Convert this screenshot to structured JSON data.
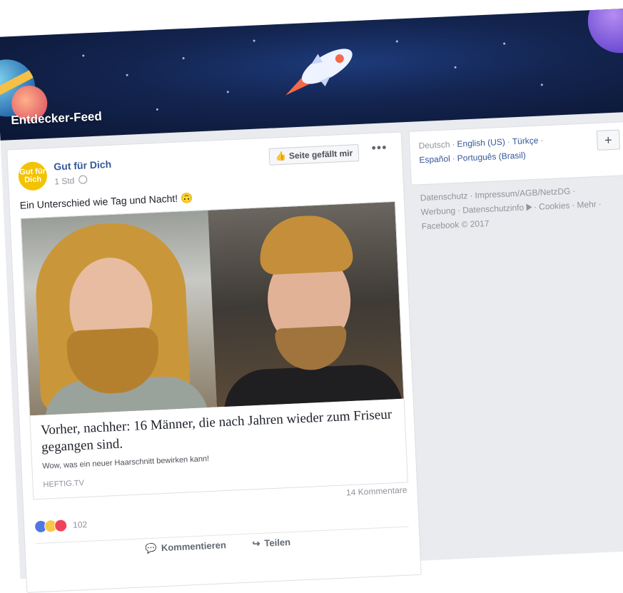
{
  "banner": {
    "title": "Entdecker-Feed"
  },
  "post": {
    "avatar_text": "Gut für Dich",
    "page_name": "Gut für Dich",
    "time": "1 Std",
    "like_page_label": "Seite gefällt mir",
    "more_label": "•••",
    "text": "Ein Unterschied wie Tag und Nacht! 🙃",
    "link": {
      "title": "Vorher, nachher: 16 Männer, die nach Jahren wieder zum Friseur gegangen sind.",
      "description": "Wow, was ein neuer Haarschnitt bewirken kann!",
      "domain": "HEFTIG.TV"
    },
    "comments_count": "14 Kommentare",
    "reactions": {
      "icons": [
        "like-icon",
        "wow-icon",
        "love-icon"
      ],
      "count": "102"
    },
    "actions": {
      "comment": "Kommentieren",
      "share": "Teilen"
    }
  },
  "languages": {
    "items": [
      {
        "label": "Deutsch",
        "current": true
      },
      {
        "label": "English (US)",
        "current": false
      },
      {
        "label": "Türkçe",
        "current": false
      },
      {
        "label": "Español",
        "current": false
      },
      {
        "label": "Português (Brasil)",
        "current": false
      }
    ],
    "add_label": "+"
  },
  "footer": {
    "datenschutz": "Datenschutz",
    "impressum": "Impressum/AGB/NetzDG",
    "werbung": "Werbung",
    "datenschutzinfo": "Datenschutzinfo",
    "cookies": "Cookies",
    "mehr": "Mehr",
    "copyright": "Facebook © 2017"
  },
  "colors": {
    "link": "#365899",
    "muted": "#90949c",
    "background": "#e9ebee"
  }
}
